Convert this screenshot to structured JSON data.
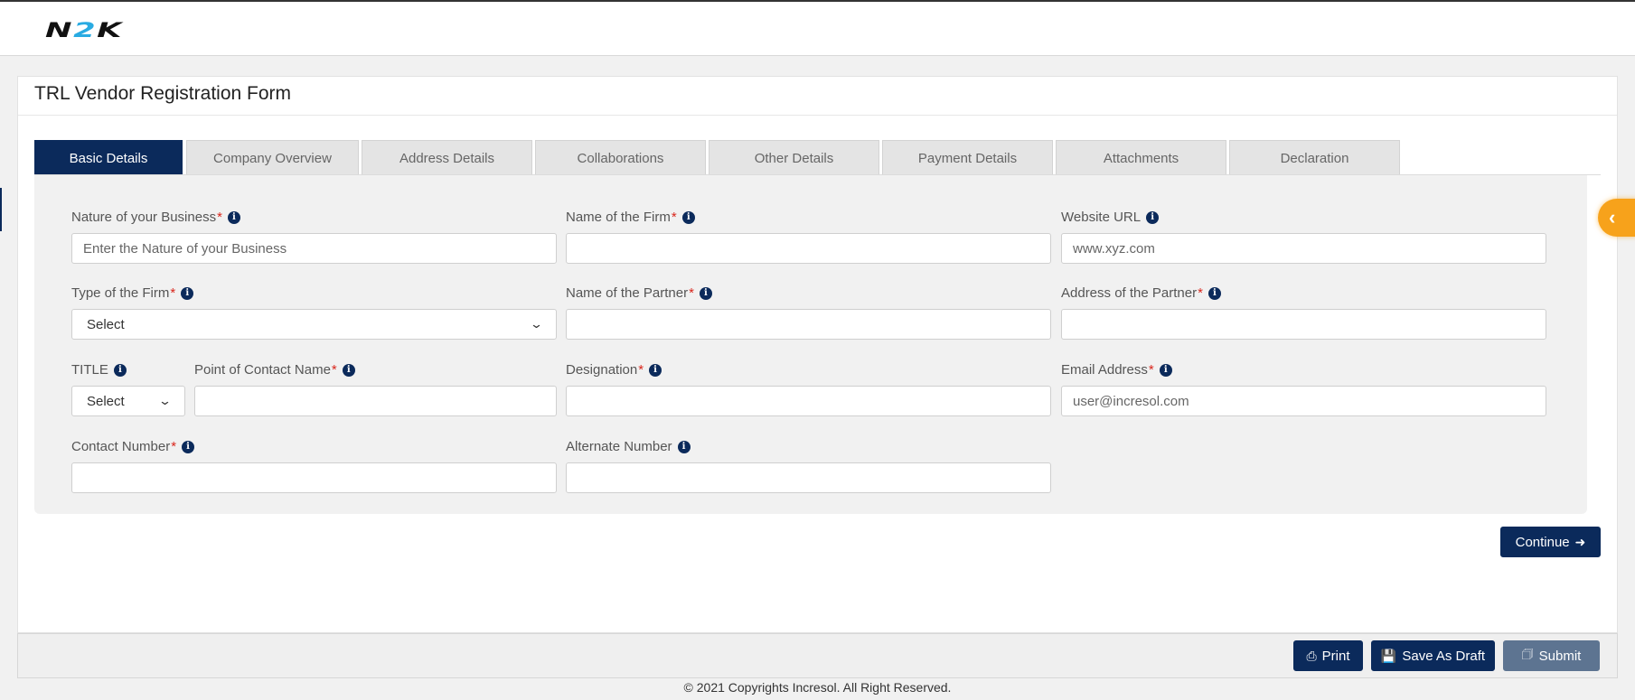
{
  "header": {
    "logo_left": "N",
    "logo_mid": "2",
    "logo_right": "K"
  },
  "card": {
    "title": "TRL Vendor Registration Form"
  },
  "tabs": [
    {
      "label": "Basic Details"
    },
    {
      "label": "Company Overview"
    },
    {
      "label": "Address Details"
    },
    {
      "label": "Collaborations"
    },
    {
      "label": "Other Details"
    },
    {
      "label": "Payment Details"
    },
    {
      "label": "Attachments"
    },
    {
      "label": "Declaration"
    }
  ],
  "form": {
    "nature_label": "Nature of your Business ",
    "nature_placeholder": "Enter the Nature of your Business",
    "firm_name_label": "Name of the Firm",
    "website_label": "Website URL",
    "website_placeholder": "www.xyz.com",
    "firm_type_label": "Type of the Firm",
    "firm_type_value": "Select",
    "partner_name_label": "Name of the Partner",
    "partner_address_label": "Address of the Partner",
    "title_label": "TITLE",
    "title_value": "Select",
    "contact_name_label": "Point of Contact Name",
    "designation_label": "Designation",
    "email_label": "Email Address",
    "email_placeholder": "user@incresol.com",
    "contact_number_label": "Contact Number",
    "alternate_number_label": "Alternate Number",
    "required_mark": "*",
    "info_glyph": "i"
  },
  "actions": {
    "continue_label": "Continue",
    "print_label": "Print",
    "save_draft_label": "Save As Draft",
    "submit_label": "Submit"
  },
  "footer": {
    "copyright": "© 2021 Copyrights Incresol. All Right Reserved."
  },
  "colors": {
    "primary": "#0b2a5b",
    "accent": "#f7a21b",
    "required": "#d9261c"
  },
  "icons": {
    "continue": "arrow-circle-right-icon",
    "print": "printer-icon",
    "save": "floppy-disk-icon",
    "submit": "id-card-icon",
    "side_toggle": "chevron-left-icon"
  }
}
